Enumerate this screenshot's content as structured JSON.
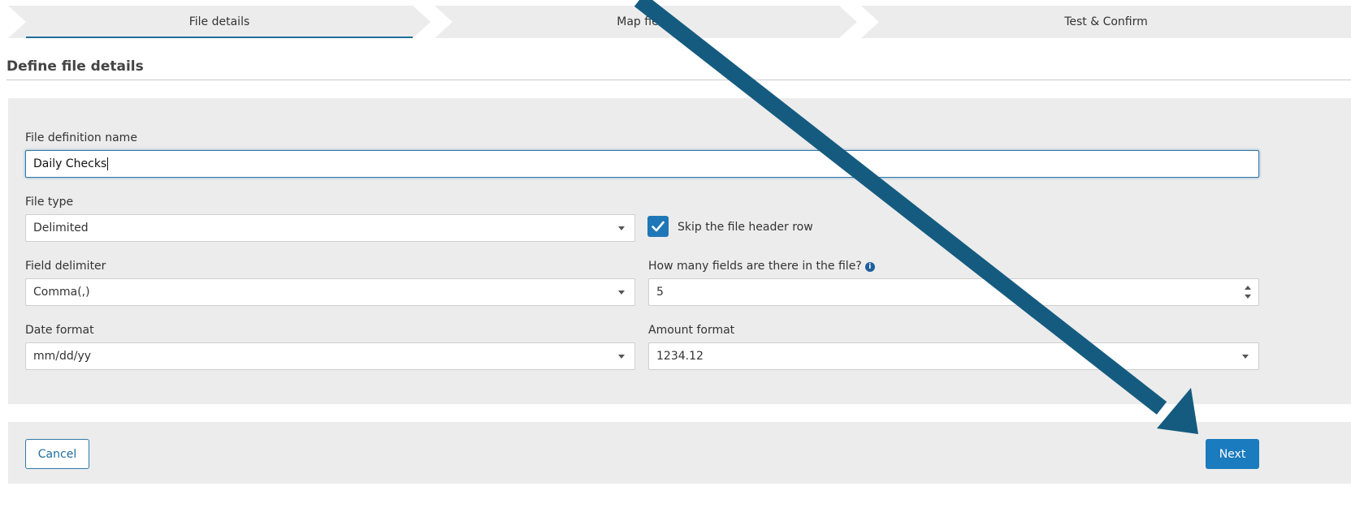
{
  "wizard": {
    "steps": [
      {
        "label": "File details",
        "active": true
      },
      {
        "label": "Map fields",
        "active": false
      },
      {
        "label": "Test & Confirm",
        "active": false
      }
    ],
    "accent_color": "#1f6f9a"
  },
  "page": {
    "title": "Define file details"
  },
  "form": {
    "file_definition_name": {
      "label": "File definition name",
      "value": "Daily Checks"
    },
    "file_type": {
      "label": "File type",
      "value": "Delimited"
    },
    "skip_header": {
      "label": "Skip the file header row",
      "checked": true
    },
    "field_delimiter": {
      "label": "Field delimiter",
      "value": "Comma(,)"
    },
    "field_count": {
      "label": "How many fields are there in the file?",
      "value": "5",
      "icon": "info-icon"
    },
    "date_format": {
      "label": "Date format",
      "value": "mm/dd/yy"
    },
    "amount_format": {
      "label": "Amount format",
      "value": "1234.12"
    }
  },
  "footer": {
    "cancel_label": "Cancel",
    "next_label": "Next"
  },
  "annotation": {
    "icon": "arrow-icon",
    "color": "#155b80"
  }
}
